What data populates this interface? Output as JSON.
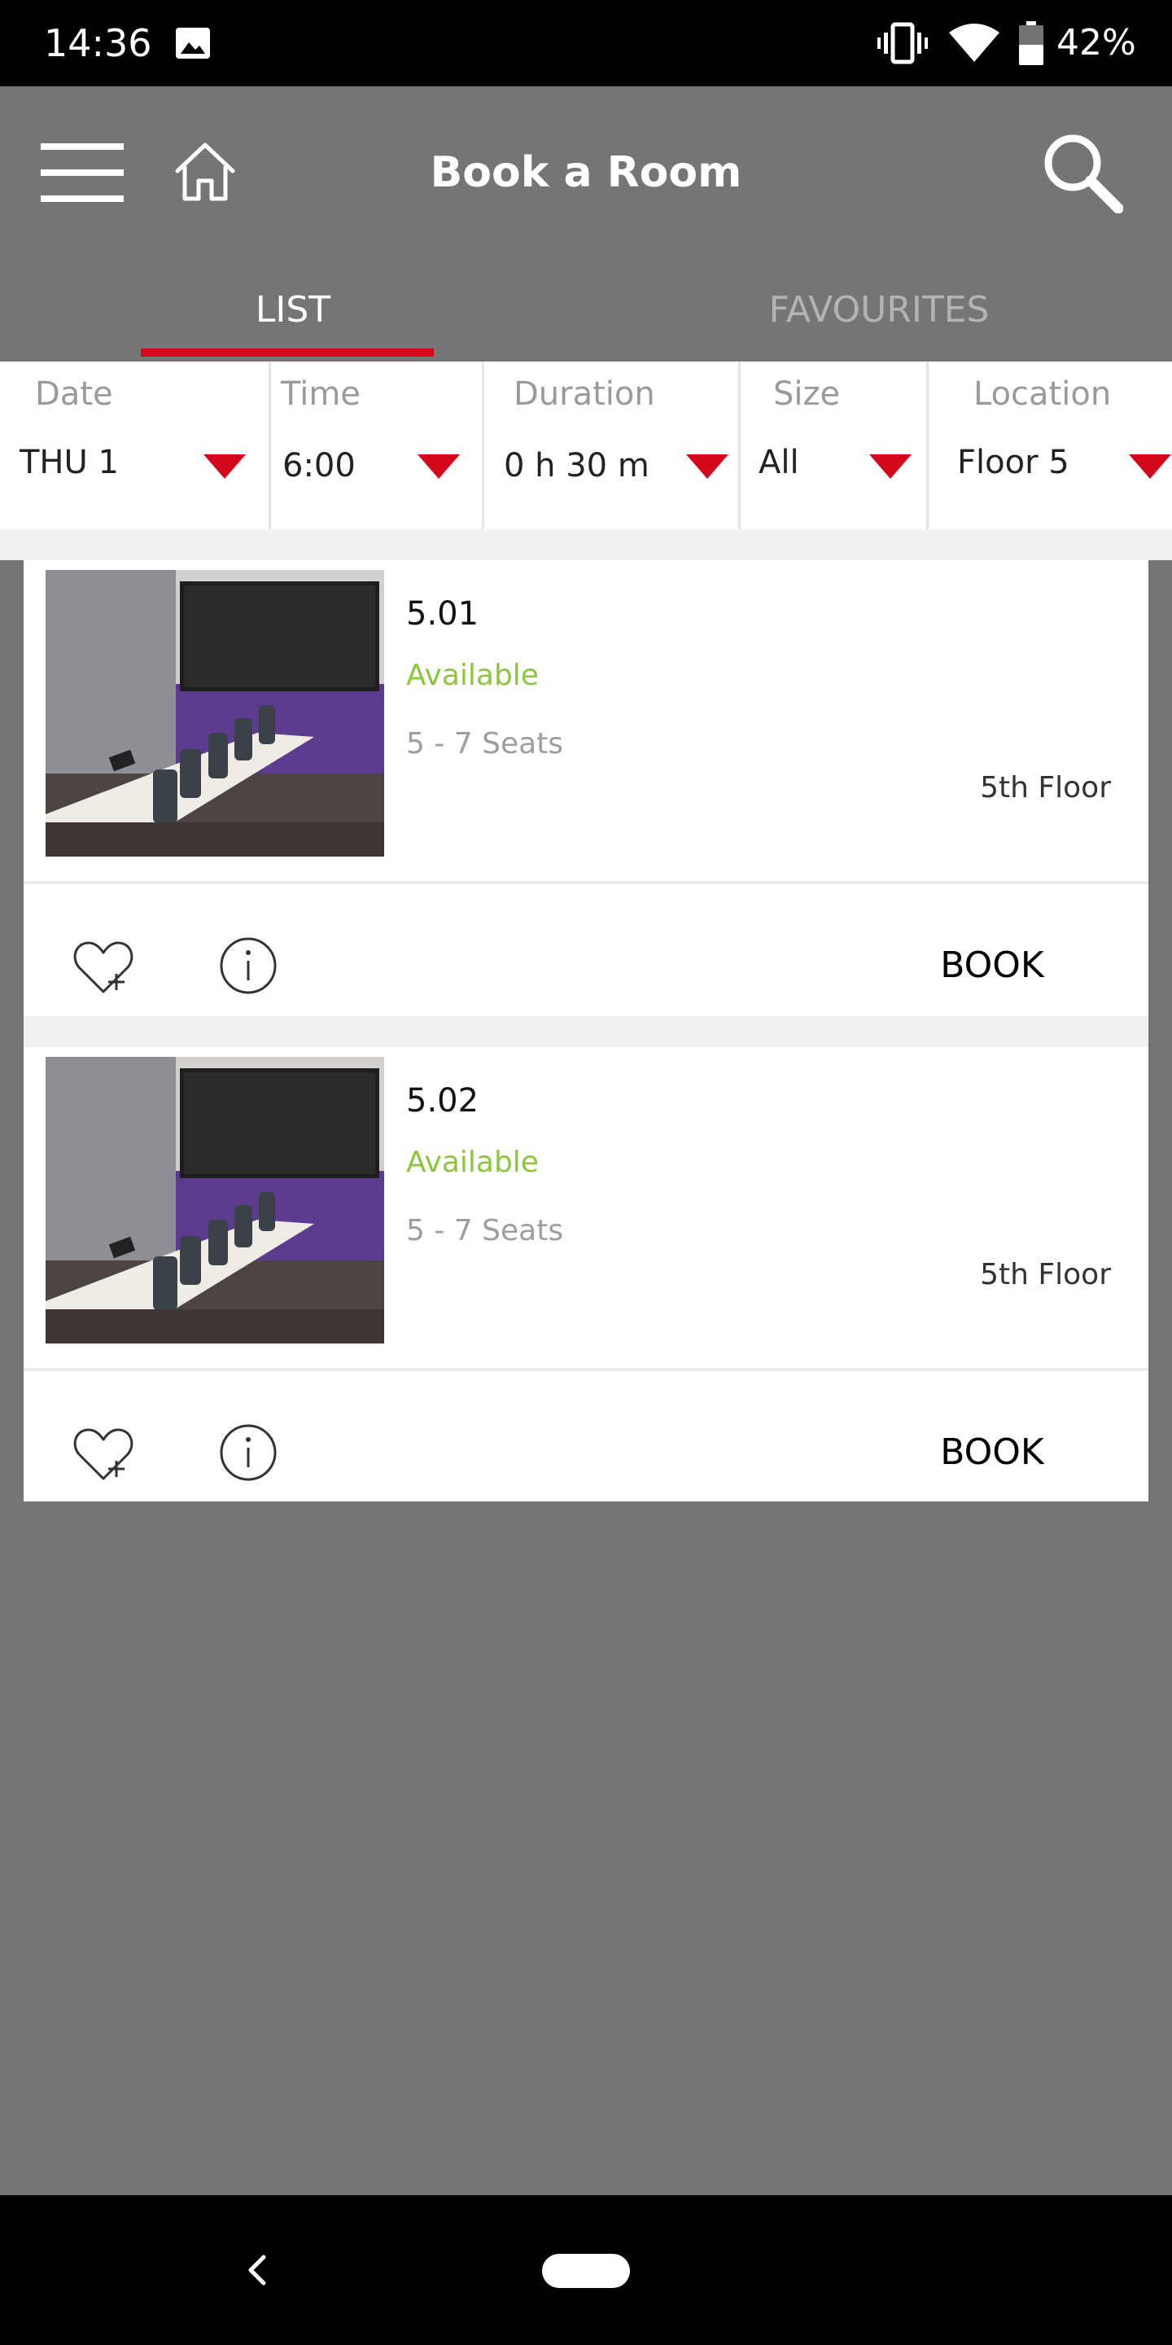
{
  "status_bar": {
    "time": "14:36",
    "battery": "42%",
    "icons": [
      "image-icon",
      "vibrate-icon",
      "wifi-icon",
      "battery-icon"
    ]
  },
  "header": {
    "title": "Book a Room",
    "icons": [
      "menu-icon",
      "home-icon",
      "search-icon"
    ]
  },
  "tabs": [
    {
      "label": "LIST",
      "active": true
    },
    {
      "label": "FAVOURITES",
      "active": false
    }
  ],
  "filters": [
    {
      "label": "Date",
      "value": "THU 1"
    },
    {
      "label": "Time",
      "value": "6:00"
    },
    {
      "label": "Duration",
      "value": "0 h 30 m"
    },
    {
      "label": "Size",
      "value": "All"
    },
    {
      "label": "Location",
      "value": "Floor 5"
    }
  ],
  "rooms": [
    {
      "name": "5.01",
      "status": "Available",
      "seats": "5 - 7 Seats",
      "floor": "5th Floor",
      "book_label": "BOOK"
    },
    {
      "name": "5.02",
      "status": "Available",
      "seats": "5 - 7 Seats",
      "floor": "5th Floor",
      "book_label": "BOOK"
    }
  ],
  "colors": {
    "accent": "#cf0a1d",
    "available": "#8cc63e",
    "header_bg": "#757575"
  }
}
